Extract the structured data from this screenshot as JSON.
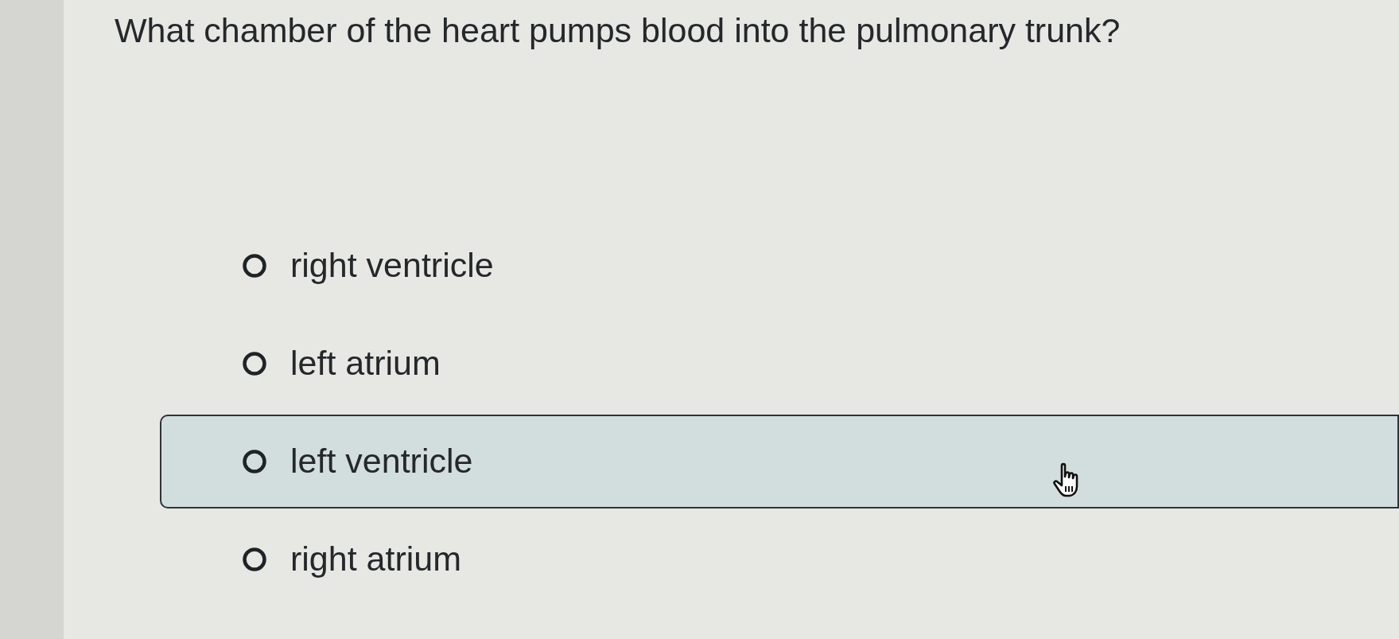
{
  "question": "What chamber of the heart pumps blood into the pulmonary trunk?",
  "options": [
    {
      "label": "right ventricle",
      "selected": false,
      "hovered": false
    },
    {
      "label": "left atrium",
      "selected": false,
      "hovered": false
    },
    {
      "label": "left ventricle",
      "selected": false,
      "hovered": true
    },
    {
      "label": "right atrium",
      "selected": false,
      "hovered": false
    }
  ]
}
